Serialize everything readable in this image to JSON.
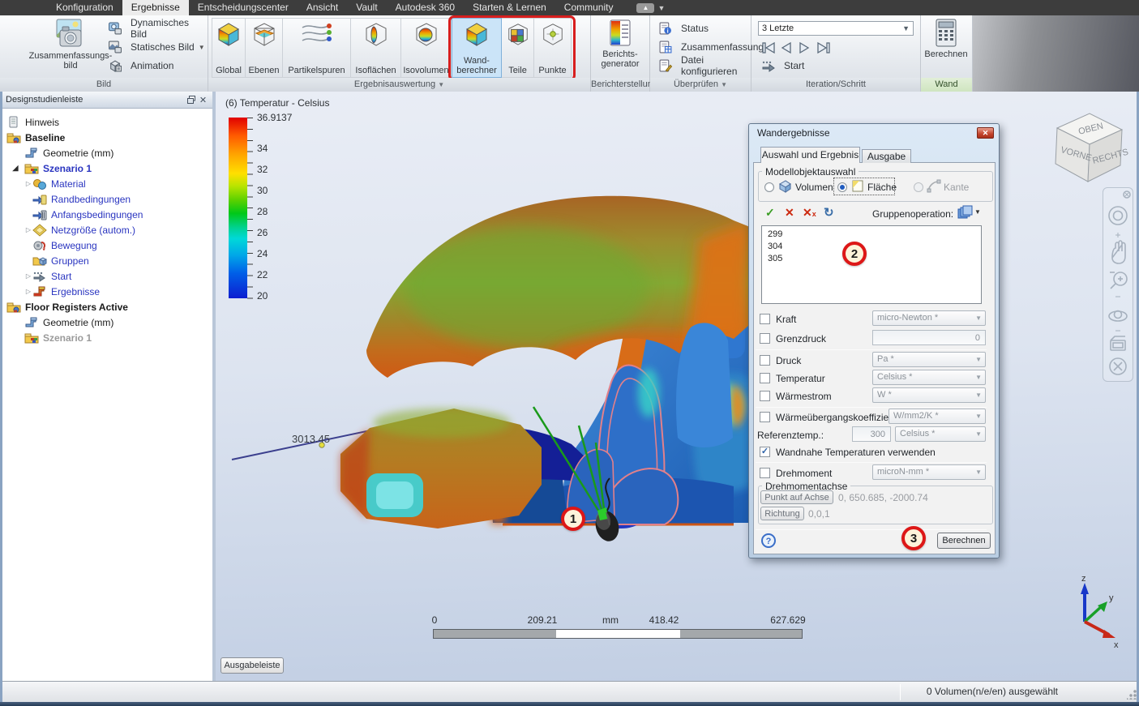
{
  "menu": {
    "items": [
      "Konfiguration",
      "Ergebnisse",
      "Entscheidungscenter",
      "Ansicht",
      "Vault",
      "Autodesk 360",
      "Starten & Lernen",
      "Community"
    ],
    "active_item": "Ergebnisse"
  },
  "ribbon": {
    "bild": {
      "label": "Bild",
      "big_button": "Zusammenfassungs-\nbild",
      "dynamic": "Dynamisches Bild",
      "static": "Statisches Bild",
      "animation": "Animation"
    },
    "auswertung": {
      "label": "Ergebnisauswertung",
      "buttons": [
        "Global",
        "Ebenen",
        "Partikelspuren",
        "Isoflächen",
        "Isovolumen",
        "Wand-\nberechner",
        "Teile",
        "Punkte"
      ],
      "highlighted": "Wand-berechner"
    },
    "bericht": {
      "label": "Berichterstellung",
      "button": "Berichts-\ngenerator"
    },
    "ueberpruefen": {
      "label": "Überprüfen",
      "items": [
        "Status",
        "Zusammenfassung",
        "Datei konfigurieren"
      ]
    },
    "iteration": {
      "label": "Iteration/Schritt",
      "dropdown_value": "3 Letzte",
      "start": "Start"
    },
    "wand": {
      "label": "Wand",
      "button": "Berechnen"
    }
  },
  "sidebar": {
    "title": "Designstudienleiste",
    "tree": [
      {
        "label": "Hinweis"
      },
      {
        "label": "Baseline"
      },
      {
        "label": "Geometrie (mm)"
      },
      {
        "label": "Szenario 1"
      },
      {
        "label": "Material"
      },
      {
        "label": "Randbedingungen"
      },
      {
        "label": "Anfangsbedingungen"
      },
      {
        "label": "Netzgröße (autom.)"
      },
      {
        "label": "Bewegung"
      },
      {
        "label": "Gruppen"
      },
      {
        "label": "Start"
      },
      {
        "label": "Ergebnisse"
      },
      {
        "label": "Floor Registers Active"
      },
      {
        "label": "Geometrie (mm)"
      },
      {
        "label": "Szenario 1"
      }
    ]
  },
  "legend": {
    "title": "(6) Temperatur - Celsius",
    "labels": [
      "36.9137",
      "34",
      "32",
      "30",
      "28",
      "26",
      "24",
      "22",
      "20"
    ],
    "max": 36.9137,
    "min": 20,
    "unit": "Celsius"
  },
  "viewport": {
    "dimension_label": "3013.45",
    "ruler_ticks": [
      "0",
      "209.21",
      "mm",
      "418.42",
      "627.629"
    ],
    "output_bar_button": "Ausgabeleiste",
    "annotations": [
      "1",
      "2",
      "3"
    ],
    "viewcube": {
      "top": "OBEN",
      "front": "VORNE",
      "right": "RECHTS"
    },
    "axes": {
      "x": "x",
      "y": "y",
      "z": "z"
    }
  },
  "dialog": {
    "title": "Wandergebnisse",
    "tabs": [
      "Auswahl und Ergebnis",
      "Ausgabe"
    ],
    "model_group_label": "Modellobjektauswahl",
    "radios": [
      "Volumen",
      "Fläche",
      "Kante"
    ],
    "selected_radio": "Fläche",
    "group_operation_label": "Gruppenoperation:",
    "list_items": [
      "299",
      "304",
      "305"
    ],
    "rows": [
      {
        "label": "Kraft",
        "unit": "micro-Newton *",
        "checked": false
      },
      {
        "label": "Grenzdruck",
        "value": "0",
        "checked": false
      },
      {
        "label": "Druck",
        "unit": "Pa *",
        "checked": false
      },
      {
        "label": "Temperatur",
        "unit": "Celsius *",
        "checked": false
      },
      {
        "label": "Wärmestrom",
        "unit": "W *",
        "checked": false
      },
      {
        "label": "Wärmeübergangskoeffizient",
        "unit": "W/mm2/K *",
        "checked": false
      }
    ],
    "referenztemp": {
      "label": "Referenztemp.:",
      "value": "300",
      "unit": "Celsius *"
    },
    "wandnahe_label": "Wandnahe Temperaturen verwenden",
    "wandnahe_checked": true,
    "check_glyph": "✓",
    "drehmoment": {
      "label": "Drehmoment",
      "unit": "microN-mm *",
      "checked": false
    },
    "achse": {
      "label": "Drehmomentachse",
      "point_button": "Punkt auf Achse",
      "point_value": "0, 650.685, -2000.74",
      "richtung_button": "Richtung",
      "richtung_value": "0,0,1"
    },
    "berechnen_button": "Berechnen"
  },
  "statusbar": {
    "selection": "0 Volumen(n/e/en) ausgewählt"
  },
  "colors": {
    "annotation_red": "#d81e1e",
    "highlight_blue": "#cbe4f8",
    "wand_group_green": "#d8eac8",
    "legend_top": "#e00000",
    "legend_bottom": "#0d1ed0"
  }
}
